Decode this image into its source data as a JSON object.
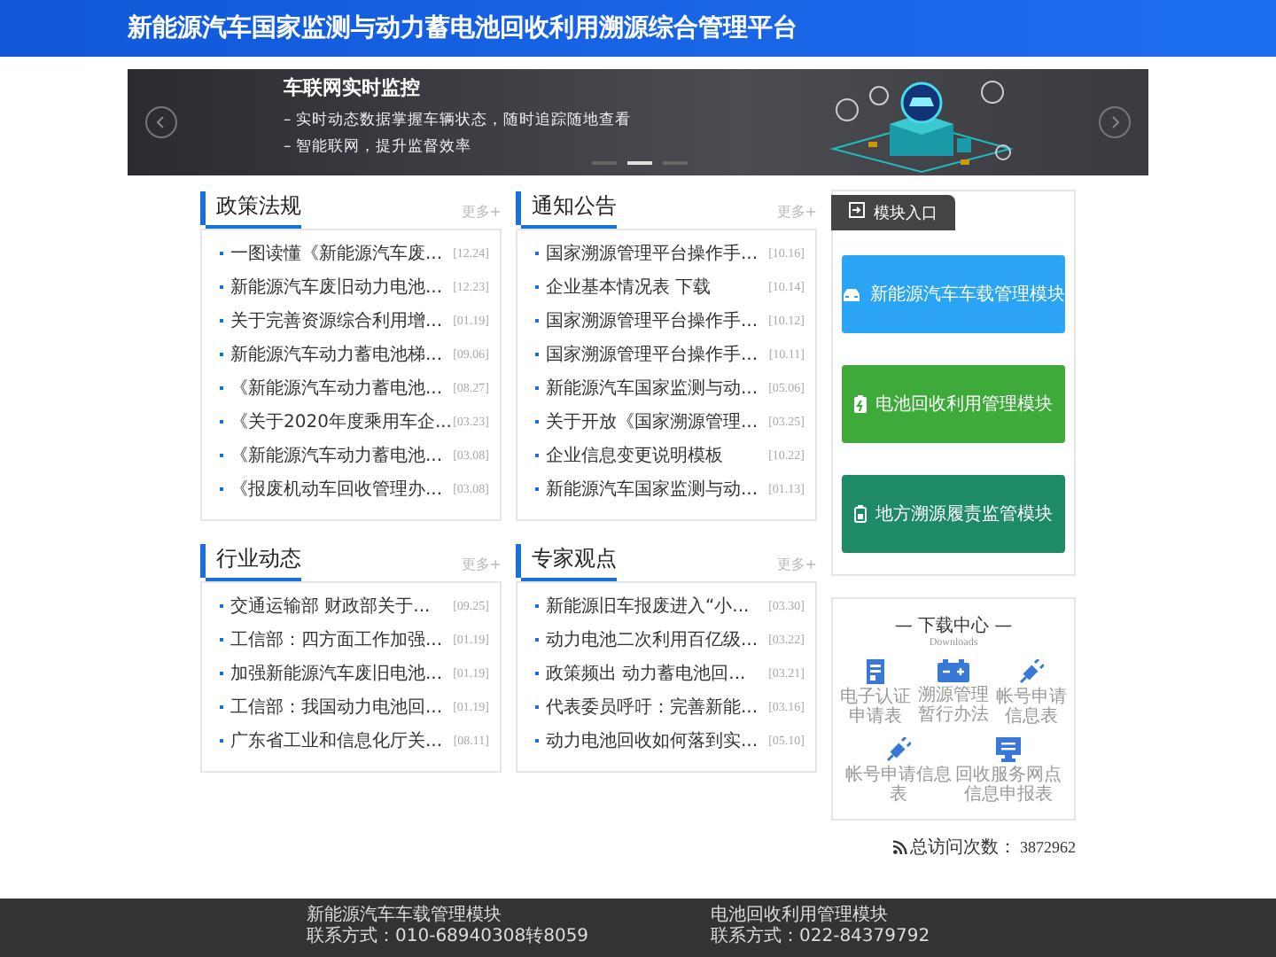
{
  "header": {
    "title": "新能源汽车国家监测与动力蓄电池回收利用溯源综合管理平台"
  },
  "banner": {
    "title": "车联网实时监控",
    "lines": [
      "– 实时动态数据掌握车辆状态，随时追踪随地查看",
      "– 智能联网，提升监督效率"
    ],
    "slides": [
      {
        "selected": false
      },
      {
        "selected": true
      },
      {
        "selected": false
      }
    ]
  },
  "panels": [
    {
      "title": "政策法规",
      "more": "更多+",
      "items": [
        {
          "text": "一图读懂《新能源汽车废...",
          "date": "[12.24]"
        },
        {
          "text": "新能源汽车废旧动力电池...",
          "date": "[12.23]"
        },
        {
          "text": "关于完善资源综合利用增...",
          "date": "[01.19]"
        },
        {
          "text": "新能源汽车动力蓄电池梯...",
          "date": "[09.06]"
        },
        {
          "text": "《新能源汽车动力蓄电池...",
          "date": "[08.27]"
        },
        {
          "text": "《关于2020年度乘用车企...",
          "date": "[03.23]"
        },
        {
          "text": "《新能源汽车动力蓄电池...",
          "date": "[03.08]"
        },
        {
          "text": "《报废机动车回收管理办...",
          "date": "[03.08]"
        }
      ]
    },
    {
      "title": "通知公告",
      "more": "更多+",
      "items": [
        {
          "text": "国家溯源管理平台操作手...",
          "date": "[10.16]"
        },
        {
          "text": "企业基本情况表 下载",
          "date": "[10.14]"
        },
        {
          "text": "国家溯源管理平台操作手...",
          "date": "[10.12]"
        },
        {
          "text": "国家溯源管理平台操作手...",
          "date": "[10.11]"
        },
        {
          "text": "新能源汽车国家监测与动...",
          "date": "[05.06]"
        },
        {
          "text": "关于开放《国家溯源管理...",
          "date": "[03.25]"
        },
        {
          "text": "企业信息变更说明模板",
          "date": "[10.22]"
        },
        {
          "text": "新能源汽车国家监测与动...",
          "date": "[01.13]"
        }
      ]
    },
    {
      "title": "行业动态",
      "more": "更多+",
      "items": [
        {
          "text": "交通运输部 财政部关于...",
          "date": "[09.25]"
        },
        {
          "text": "工信部：四方面工作加强...",
          "date": "[01.19]"
        },
        {
          "text": "加强新能源汽车废旧电池...",
          "date": "[01.19]"
        },
        {
          "text": "工信部：我国动力电池回...",
          "date": "[01.19]"
        },
        {
          "text": "广东省工业和信息化厅关...",
          "date": "[08.11]"
        }
      ]
    },
    {
      "title": "专家观点",
      "more": "更多+",
      "items": [
        {
          "text": "新能源旧车报废进入“小...",
          "date": "[03.30]"
        },
        {
          "text": "动力电池二次利用百亿级...",
          "date": "[03.22]"
        },
        {
          "text": "政策频出 动力蓄电池回...",
          "date": "[03.21]"
        },
        {
          "text": "代表委员呼吁：完善新能...",
          "date": "[03.16]"
        },
        {
          "text": "动力电池回收如何落到实...",
          "date": "[05.10]"
        }
      ]
    }
  ],
  "modules": {
    "tab": "模块入口",
    "buttons": [
      {
        "label": "新能源汽车车载管理模块",
        "kind": "car",
        "color": "#2aa4f4"
      },
      {
        "label": "电池回收利用管理模块",
        "kind": "battery",
        "color": "#3eaa3a"
      },
      {
        "label": "地方溯源履责监管模块",
        "kind": "battery-outline",
        "color": "#1e8a68"
      }
    ]
  },
  "downloads": {
    "title": "— 下载中心 —",
    "subtitle": "Downloads",
    "items": [
      {
        "label": "电子认证申请表",
        "kind": "document"
      },
      {
        "label": "溯源管理暂行办法",
        "kind": "battery"
      },
      {
        "label": "帐号申请信息表",
        "kind": "plug"
      },
      {
        "label": "帐号申请信息表",
        "kind": "plug"
      },
      {
        "label": "回收服务网点信息申报表",
        "kind": "monitor"
      }
    ]
  },
  "visits": {
    "label": "总访问次数：",
    "count": "3872962"
  },
  "footer": [
    {
      "lines": [
        "新能源汽车车载管理模块",
        "联系方式：010-68940308转8059"
      ]
    },
    {
      "lines": [
        "电池回收利用管理模块",
        "联系方式：022-84379792"
      ]
    }
  ]
}
